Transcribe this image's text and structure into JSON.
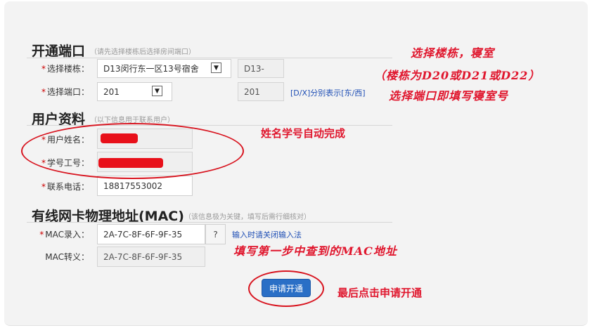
{
  "sections": {
    "port": {
      "title": "开通端口",
      "note": "（请先选择楼栋后选择房间端口）"
    },
    "user": {
      "title": "用户资料",
      "note": "（以下信息用于联系用户）"
    },
    "mac": {
      "title": "有线网卡物理地址(MAC)",
      "note": "（该信息极为关键，填写后需行细核对）"
    }
  },
  "form": {
    "building": {
      "label": "选择楼栋：",
      "value": "D13闵行东一区13号宿舍",
      "code": "D13-"
    },
    "port": {
      "label": "选择端口：",
      "value": "201",
      "code": "201",
      "hint": "[D/X]分别表示[东/西]"
    },
    "name": {
      "label": "用户姓名："
    },
    "student_id": {
      "label": "学号工号："
    },
    "phone": {
      "label": "联系电话：",
      "value": "18817553002"
    },
    "mac_input": {
      "label": "MAC录入：",
      "value": "2A-7C-8F-6F-9F-35",
      "help_button": "?",
      "hint": "输入时请关闭输入法"
    },
    "mac_convert": {
      "label": "MAC转义：",
      "value": "2A-7C-8F-6F-9F-35"
    },
    "submit": "申请开通"
  },
  "annotations": {
    "building_room": "选择楼栋，寝室",
    "building_note": "（楼栋为D20或D21或D22）",
    "port_room": "选择端口即填写寝室号",
    "auto_fill": "姓名学号自动完成",
    "mac_fill": "填写第一步中查到的MAC地址",
    "final_click": "最后点击申请开通"
  },
  "colors": {
    "annotation_red": "#e0162d",
    "button_blue": "#2a6fc6",
    "hint_blue": "#1f4fb5"
  },
  "icons": {
    "dropdown": "chevron-down-icon"
  }
}
